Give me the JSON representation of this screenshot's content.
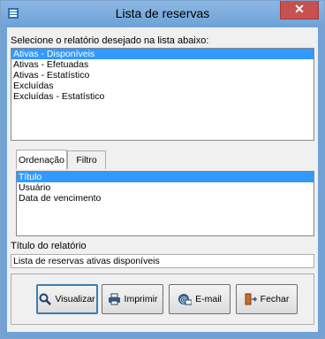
{
  "window": {
    "title": "Lista de reservas",
    "close_label": "✕"
  },
  "report_prompt": "Selecione o relatório desejado na lista abaixo:",
  "reports": [
    {
      "label": "Ativas - Disponíveis",
      "selected": true
    },
    {
      "label": "Ativas - Efetuadas",
      "selected": false
    },
    {
      "label": "Ativas - Estatístico",
      "selected": false
    },
    {
      "label": "Excluídas",
      "selected": false
    },
    {
      "label": "Excluídas - Estatístico",
      "selected": false
    }
  ],
  "tabs": [
    {
      "label": "Ordenação",
      "active": true
    },
    {
      "label": "Filtro",
      "active": false
    }
  ],
  "ordering": [
    {
      "label": "Título",
      "selected": true
    },
    {
      "label": "Usuário",
      "selected": false
    },
    {
      "label": "Data de vencimento",
      "selected": false
    }
  ],
  "report_title_label": "Título do relatório",
  "report_title_value": "Lista de reservas ativas disponíveis",
  "buttons": {
    "view": {
      "label": "Visualizar",
      "icon": "magnifier-icon"
    },
    "print": {
      "label": "Imprimir",
      "icon": "printer-icon"
    },
    "email": {
      "label": "E-mail",
      "icon": "email-icon"
    },
    "close": {
      "label": "Fechar",
      "icon": "exit-door-icon"
    }
  }
}
